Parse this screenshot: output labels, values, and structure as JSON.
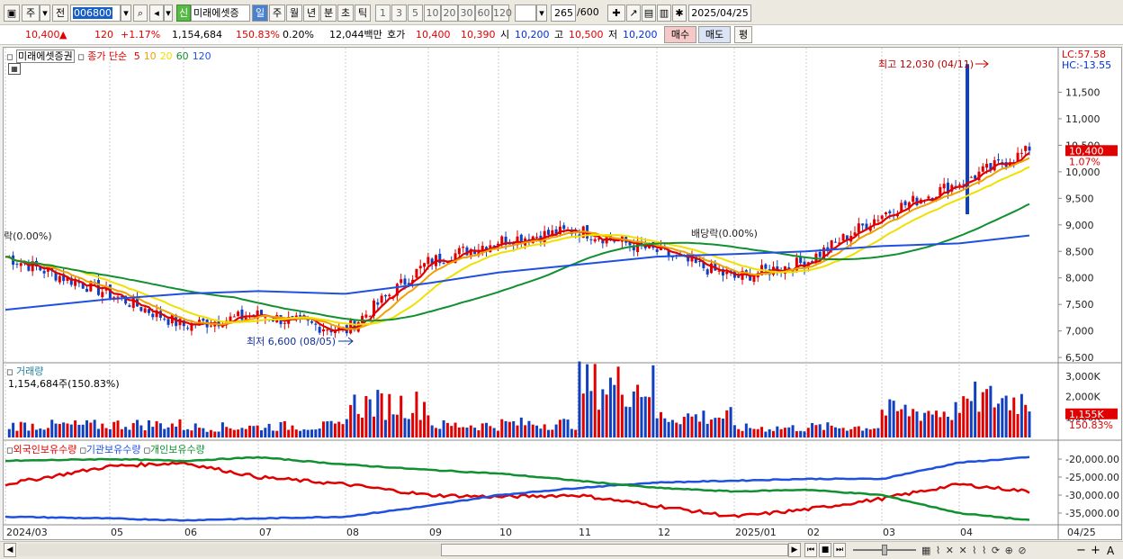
{
  "toolbar": {
    "market": "주",
    "prefix": "전",
    "code": "006800",
    "badge": "신",
    "name": "미래에셋증",
    "periods": [
      "일",
      "주",
      "월",
      "년",
      "분",
      "초",
      "틱"
    ],
    "active_period": "일",
    "intervals": [
      "1",
      "3",
      "5",
      "10",
      "20",
      "30",
      "60",
      "120"
    ],
    "count": "265",
    "count_total": "/600",
    "date": "2025/04/25"
  },
  "quote": {
    "price": "10,400",
    "arrow": "▲",
    "change": "120",
    "change_pct": "+1.17%",
    "volume": "1,154,684",
    "vol_ratio": "150.83%",
    "turnover": "0.20%",
    "amount": "12,044백만",
    "hoga_label": "호가",
    "bid": "10,400",
    "ask": "10,390",
    "open_label": "시",
    "open": "10,200",
    "high_label": "고",
    "high": "10,500",
    "low_label": "저",
    "low": "10,200",
    "buy_button": "매수",
    "sell_button": "매도",
    "eval_button": "평"
  },
  "price_panel": {
    "stock_label": "미래에셋증권",
    "ma_label": "종가 단순",
    "ma_periods": [
      "5",
      "10",
      "20",
      "60",
      "120"
    ],
    "ma_colors": [
      "#e00000",
      "#f0a000",
      "#f0e000",
      "#109030",
      "#2050e0"
    ],
    "lc": "LC:57.58",
    "hc": "HC:-13.55",
    "high_note": "최고 12,030 (04/11)",
    "low_note": "최저 6,600 (08/05)",
    "left_note": "락(0.00%)",
    "mid_note": "배당락(0.00%)",
    "price_ticks": [
      "11,500",
      "11,000",
      "10,500",
      "10,000",
      "9,500",
      "9,000",
      "8,500",
      "8,000",
      "7,500",
      "7,000",
      "6,500"
    ],
    "last_tag": "10,400",
    "last_pct": "1.07%"
  },
  "volume_panel": {
    "title": "거래량",
    "value": "1,154,684주(150.83%)",
    "ticks": [
      "3,000K",
      "2,000K",
      "1,000K"
    ],
    "last_tag": "1,155K",
    "last_pct": "150.83%"
  },
  "holding_panel": {
    "legend": [
      "외국인보유수량",
      "기관보유수량",
      "개인보유수량"
    ],
    "legend_colors": [
      "#e00000",
      "#2050e0",
      "#109030"
    ],
    "ticks": [
      "-20,000.00",
      "-25,000.00",
      "-30,000.00",
      "-35,000.00"
    ]
  },
  "x_axis": {
    "labels": [
      "2024/03",
      "05",
      "06",
      "07",
      "08",
      "09",
      "10",
      "11",
      "12",
      "2025/01",
      "02",
      "03",
      "04"
    ],
    "last": "04/25"
  },
  "chart_data": [
    {
      "type": "line",
      "title": "미래에셋증권 일봉",
      "x": [
        "2024/03",
        "05",
        "06",
        "07",
        "08",
        "09",
        "10",
        "11",
        "12",
        "2025/01",
        "02",
        "03",
        "04",
        "04/25"
      ],
      "series": [
        {
          "name": "종가",
          "values": [
            8400,
            7700,
            7100,
            7300,
            7000,
            8300,
            8700,
            8900,
            8500,
            8000,
            8300,
            9200,
            9800,
            10400
          ]
        },
        {
          "name": "120",
          "values": [
            7400,
            7600,
            7700,
            7750,
            7700,
            7900,
            8100,
            8250,
            8400,
            8450,
            8500,
            8600,
            8650,
            8800
          ]
        }
      ],
      "annotations": [
        "최고 12,030 (04/11)",
        "최저 6,600 (08/05)"
      ],
      "ylim": [
        6300,
        12200
      ]
    },
    {
      "type": "bar",
      "title": "거래량",
      "x": [
        "2024/03",
        "05",
        "06",
        "07",
        "08",
        "09",
        "10",
        "11",
        "12",
        "2025/01",
        "02",
        "03",
        "04",
        "04/25"
      ],
      "values": [
        700,
        750,
        600,
        650,
        1900,
        700,
        800,
        3000,
        1200,
        550,
        600,
        1500,
        2200,
        1155
      ],
      "ylim": [
        0,
        3300
      ]
    },
    {
      "type": "line",
      "title": "보유수량",
      "x": [
        "2024/03",
        "05",
        "06",
        "07",
        "08",
        "09",
        "10",
        "11",
        "12",
        "2025/01",
        "02",
        "03",
        "04",
        "04/25"
      ],
      "series": [
        {
          "name": "외국인보유수량",
          "values": [
            -27000,
            -22000,
            -21000,
            -25000,
            -27000,
            -30000,
            -30500,
            -30000,
            -33000,
            -36000,
            -34000,
            -31000,
            -27000,
            -29000
          ]
        },
        {
          "name": "기관보유수량",
          "values": [
            -36000,
            -36500,
            -37000,
            -36500,
            -36000,
            -33000,
            -30000,
            -28000,
            -26500,
            -26000,
            -25500,
            -25500,
            -21000,
            -19500
          ]
        },
        {
          "name": "개인보유수량",
          "values": [
            -20500,
            -20000,
            -20500,
            -19500,
            -21500,
            -23000,
            -24000,
            -26000,
            -28000,
            -29000,
            -28500,
            -30000,
            -35000,
            -37000
          ]
        }
      ],
      "ylim": [
        -38000,
        -18000
      ]
    }
  ]
}
